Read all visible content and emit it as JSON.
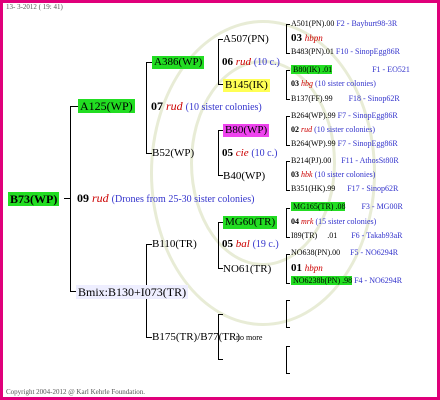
{
  "date_text": "13- 3-2012 ( 19: 41)",
  "copyright": "Copyright 2004-2012 @ Karl Kehrle Foundation.",
  "root": {
    "label": "B73(WP)",
    "num": "09",
    "race": "rud",
    "note": "(Drones from 25-30 sister colonies)"
  },
  "left_upper": {
    "label": "A125(WP)",
    "num": "07",
    "race": "rud",
    "note": "(10 sister colonies)"
  },
  "left_lower": {
    "label": "Bmix:B130+I073(TR)"
  },
  "mid": [
    {
      "label": "A386(WP)",
      "num": "06",
      "race": "rud",
      "note": "(10 c.)"
    },
    {
      "label": "B52(WP)",
      "num": "05",
      "race": "cie",
      "note": "(10 c.)"
    },
    {
      "label": "B110(TR)",
      "num": "05",
      "race": "bal",
      "note": "(19 c.)"
    },
    {
      "label": "B175(TR)/B77(TR)",
      "note": "no more"
    }
  ],
  "gen3": [
    {
      "label": "A507(PN)",
      "num": "03",
      "race": "hbpn"
    },
    {
      "label": "B145(IK)",
      "num": "03",
      "race": "hbg",
      "note": "(10 sister colonies)"
    },
    {
      "label": "B80(WP)",
      "num": "02",
      "race": "rud",
      "note": "(10 sister colonies)"
    },
    {
      "label": "B40(WP)",
      "num": "03",
      "race": "hbk",
      "note": "(10 sister colonies)"
    },
    {
      "label": "MG60(TR)",
      "num": "04",
      "race": "mrk",
      "note": "(15 sister colonies)"
    },
    {
      "label": "NO61(TR)",
      "num": "01",
      "race": "hbpn"
    }
  ],
  "gen4": [
    {
      "label": "A501(PN)",
      "sep": ".00",
      "code": "F2 - Bayburt98-3R"
    },
    {
      "label": "B483(PN)",
      "sep": ".01",
      "code": "F10 - SinopEgg86R"
    },
    {
      "label": "B80(IK)",
      "sep": ".01",
      "code": "F1 - EO521"
    },
    {
      "label": "B137(FF)",
      "sep": ".99",
      "code": "F18 - Sinop62R"
    },
    {
      "label": "B264(WP)",
      "sep": ".99",
      "code": "F7 - SinopEgg86R"
    },
    {
      "label": "B264(WP)",
      "sep": ".99",
      "code": "F7 - SinopEgg86R"
    },
    {
      "label": "B214(PJ)",
      "sep": ".00",
      "code": "F11 - AthosSt80R"
    },
    {
      "label": "B351(HK)",
      "sep": ".99",
      "code": "F17 - Sinop62R"
    },
    {
      "label": "MG165(TR)",
      "sep": ".08",
      "code": "F3 - MG00R"
    },
    {
      "label": "I89(TR)",
      "sep": ".01",
      "code": "F6 - Takab93aR"
    },
    {
      "label": "NO638(PN)",
      "sep": ".00",
      "code": "F5 - NO6294R"
    },
    {
      "label": "NO6238b(PN)",
      "sep": ".98",
      "code": "F4 - NO6294R"
    }
  ]
}
